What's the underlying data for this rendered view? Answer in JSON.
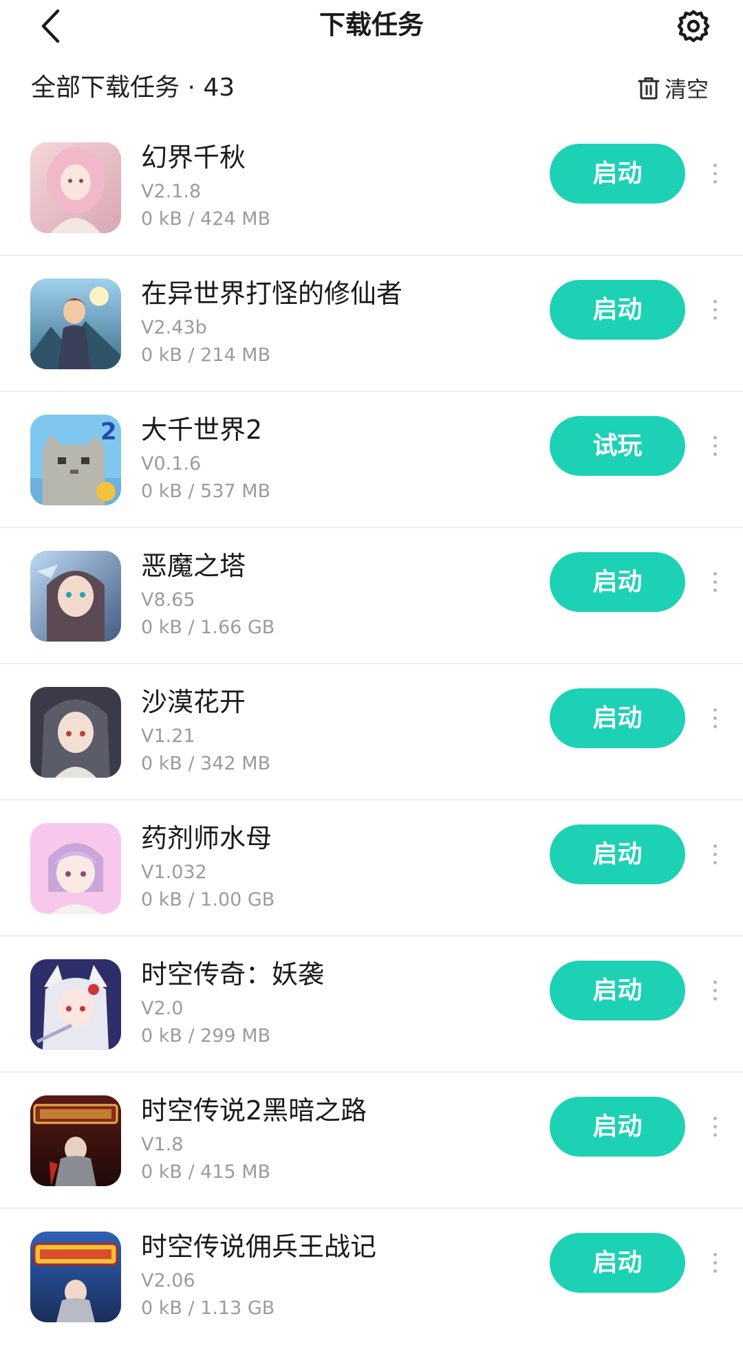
{
  "header": {
    "title": "下载任务"
  },
  "subheader": {
    "total_label": "全部下载任务 · 43",
    "clear_label": "清空"
  },
  "colors": {
    "accent": "#1dd1b5",
    "muted_text": "#9b9b9b",
    "divider": "#eeeeee"
  },
  "icons": {
    "back": "chevron-left-icon",
    "settings": "gear-icon",
    "clear": "trash-icon",
    "more": "more-vertical-icon"
  },
  "downloads": [
    {
      "name": "幻界千秋",
      "version": "V2.1.8",
      "size": "0 kB / 424 MB",
      "action": "启动"
    },
    {
      "name": "在异世界打怪的修仙者",
      "version": "V2.43b",
      "size": "0 kB / 214 MB",
      "action": "启动"
    },
    {
      "name": "大千世界2",
      "version": "V0.1.6",
      "size": "0 kB / 537 MB",
      "action": "试玩"
    },
    {
      "name": "恶魔之塔",
      "version": "V8.65",
      "size": "0 kB / 1.66 GB",
      "action": "启动"
    },
    {
      "name": "沙漠花开",
      "version": "V1.21",
      "size": "0 kB / 342 MB",
      "action": "启动"
    },
    {
      "name": "药剂师水母",
      "version": "V1.032",
      "size": "0 kB / 1.00 GB",
      "action": "启动"
    },
    {
      "name": "时空传奇：妖袭",
      "version": "V2.0",
      "size": "0 kB / 299 MB",
      "action": "启动"
    },
    {
      "name": "时空传说2黑暗之路",
      "version": "V1.8",
      "size": "0 kB / 415 MB",
      "action": "启动"
    },
    {
      "name": "时空传说佣兵王战记",
      "version": "V2.06",
      "size": "0 kB / 1.13 GB",
      "action": "启动"
    }
  ]
}
